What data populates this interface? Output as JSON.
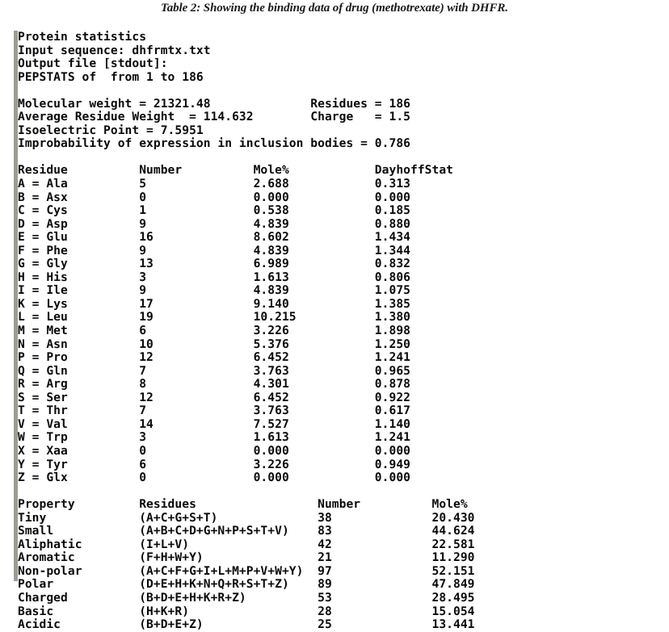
{
  "caption": "Table 2: Showing the binding data of drug (methotrexate) with DHFR.",
  "terminal": {
    "header_lines": [
      "Protein statistics",
      "Input sequence: dhfrmtx.txt",
      "Output file [stdout]:",
      "PEPSTATS of  from 1 to 186"
    ],
    "summary": {
      "molecular_weight_label": "Molecular weight",
      "molecular_weight": "21321.48",
      "residues_label": "Residues",
      "residues": "186",
      "average_residue_weight_label": "Average Residue Weight",
      "average_residue_weight": "114.632",
      "charge_label": "Charge",
      "charge": "1.5",
      "isoelectric_point_label": "Isoelectric Point",
      "isoelectric_point": "7.5951",
      "improbability_label": "Improbability of expression in inclusion bodies",
      "improbability": "0.786"
    },
    "residue_table": {
      "headers": [
        "Residue",
        "Number",
        "Mole%",
        "DayhoffStat"
      ],
      "rows": [
        {
          "code": "A",
          "name": "Ala",
          "number": "5",
          "mole_pct": "2.688",
          "dayhoff": "0.313"
        },
        {
          "code": "B",
          "name": "Asx",
          "number": "0",
          "mole_pct": "0.000",
          "dayhoff": "0.000"
        },
        {
          "code": "C",
          "name": "Cys",
          "number": "1",
          "mole_pct": "0.538",
          "dayhoff": "0.185"
        },
        {
          "code": "D",
          "name": "Asp",
          "number": "9",
          "mole_pct": "4.839",
          "dayhoff": "0.880"
        },
        {
          "code": "E",
          "name": "Glu",
          "number": "16",
          "mole_pct": "8.602",
          "dayhoff": "1.434"
        },
        {
          "code": "F",
          "name": "Phe",
          "number": "9",
          "mole_pct": "4.839",
          "dayhoff": "1.344"
        },
        {
          "code": "G",
          "name": "Gly",
          "number": "13",
          "mole_pct": "6.989",
          "dayhoff": "0.832"
        },
        {
          "code": "H",
          "name": "His",
          "number": "3",
          "mole_pct": "1.613",
          "dayhoff": "0.806"
        },
        {
          "code": "I",
          "name": "Ile",
          "number": "9",
          "mole_pct": "4.839",
          "dayhoff": "1.075"
        },
        {
          "code": "K",
          "name": "Lys",
          "number": "17",
          "mole_pct": "9.140",
          "dayhoff": "1.385"
        },
        {
          "code": "L",
          "name": "Leu",
          "number": "19",
          "mole_pct": "10.215",
          "dayhoff": "1.380"
        },
        {
          "code": "M",
          "name": "Met",
          "number": "6",
          "mole_pct": "3.226",
          "dayhoff": "1.898"
        },
        {
          "code": "N",
          "name": "Asn",
          "number": "10",
          "mole_pct": "5.376",
          "dayhoff": "1.250"
        },
        {
          "code": "P",
          "name": "Pro",
          "number": "12",
          "mole_pct": "6.452",
          "dayhoff": "1.241"
        },
        {
          "code": "Q",
          "name": "Gln",
          "number": "7",
          "mole_pct": "3.763",
          "dayhoff": "0.965"
        },
        {
          "code": "R",
          "name": "Arg",
          "number": "8",
          "mole_pct": "4.301",
          "dayhoff": "0.878"
        },
        {
          "code": "S",
          "name": "Ser",
          "number": "12",
          "mole_pct": "6.452",
          "dayhoff": "0.922"
        },
        {
          "code": "T",
          "name": "Thr",
          "number": "7",
          "mole_pct": "3.763",
          "dayhoff": "0.617"
        },
        {
          "code": "V",
          "name": "Val",
          "number": "14",
          "mole_pct": "7.527",
          "dayhoff": "1.140"
        },
        {
          "code": "W",
          "name": "Trp",
          "number": "3",
          "mole_pct": "1.613",
          "dayhoff": "1.241"
        },
        {
          "code": "X",
          "name": "Xaa",
          "number": "0",
          "mole_pct": "0.000",
          "dayhoff": "0.000"
        },
        {
          "code": "Y",
          "name": "Tyr",
          "number": "6",
          "mole_pct": "3.226",
          "dayhoff": "0.949"
        },
        {
          "code": "Z",
          "name": "Glx",
          "number": "0",
          "mole_pct": "0.000",
          "dayhoff": "0.000"
        }
      ]
    },
    "property_table": {
      "headers": [
        "Property",
        "Residues",
        "Number",
        "Mole%"
      ],
      "rows": [
        {
          "property": "Tiny",
          "residues": "(A+C+G+S+T)",
          "number": "38",
          "mole_pct": "20.430"
        },
        {
          "property": "Small",
          "residues": "(A+B+C+D+G+N+P+S+T+V)",
          "number": "83",
          "mole_pct": "44.624"
        },
        {
          "property": "Aliphatic",
          "residues": "(I+L+V)",
          "number": "42",
          "mole_pct": "22.581"
        },
        {
          "property": "Aromatic",
          "residues": "(F+H+W+Y)",
          "number": "21",
          "mole_pct": "11.290"
        },
        {
          "property": "Non-polar",
          "residues": "(A+C+F+G+I+L+M+P+V+W+Y)",
          "number": "97",
          "mole_pct": "52.151"
        },
        {
          "property": "Polar",
          "residues": "(D+E+H+K+N+Q+R+S+T+Z)",
          "number": "89",
          "mole_pct": "47.849"
        },
        {
          "property": "Charged",
          "residues": "(B+D+E+H+K+R+Z)",
          "number": "53",
          "mole_pct": "28.495"
        },
        {
          "property": "Basic",
          "residues": "(H+K+R)",
          "number": "28",
          "mole_pct": "15.054"
        },
        {
          "property": "Acidic",
          "residues": "(B+D+E+Z)",
          "number": "25",
          "mole_pct": "13.441"
        }
      ]
    }
  },
  "colors": {
    "text": "#0a0a0a",
    "border": "#9d9d92",
    "background": "#ffffff"
  }
}
